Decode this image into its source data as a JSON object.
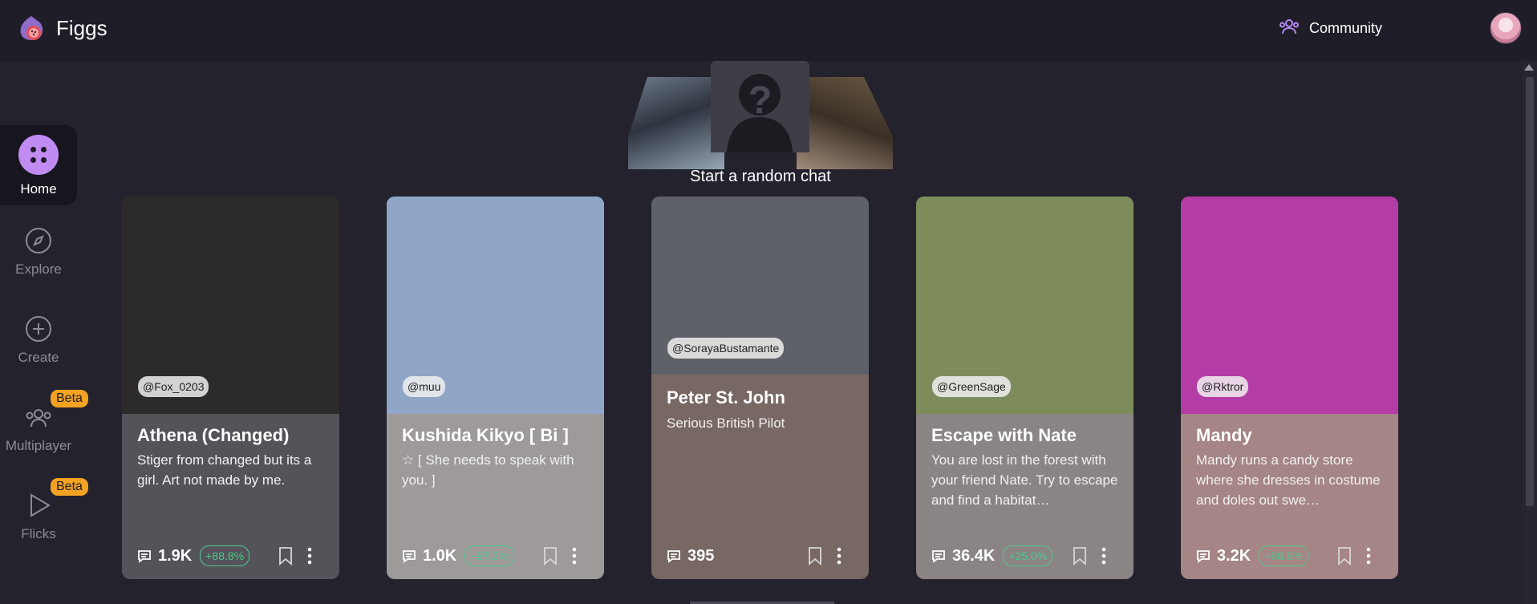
{
  "app": {
    "name": "Figgs"
  },
  "header": {
    "community_label": "Community"
  },
  "sidebar": {
    "items": [
      {
        "label": "Home"
      },
      {
        "label": "Explore"
      },
      {
        "label": "Create"
      },
      {
        "label": "Multiplayer",
        "badge": "Beta"
      },
      {
        "label": "Flicks",
        "badge": "Beta"
      }
    ]
  },
  "random_chat": {
    "label": "Start a random chat",
    "placeholder_glyph": "?"
  },
  "cards": [
    {
      "creator": "@Fox_0203",
      "name": "Athena (Changed)",
      "description": "Stiger from changed but its a girl. Art not made by me.",
      "count": "1.9K",
      "change": "+88.8%",
      "bg": "#55535a",
      "img_bg": "#2d2a2b"
    },
    {
      "creator": "@muu",
      "name": "Kushida Kikyo [ Bi ]",
      "description": "☆ [ She needs to speak with you. ]",
      "count": "1.0K",
      "change": "+97.2%",
      "bg": "#9d9a99",
      "img_bg": "#8fa6c7"
    },
    {
      "creator": "@SorayaBustamante",
      "name": "Peter St. John",
      "description": "Serious British Pilot",
      "count": "395",
      "change": "",
      "bg": "#786864",
      "img_bg": "#5e6168"
    },
    {
      "creator": "@GreenSage",
      "name": "Escape with Nate",
      "description": "You are lost in the forest with your friend Nate. Try to escape and find a habitat…",
      "count": "36.4K",
      "change": "+25.0%",
      "bg": "#8b8484",
      "img_bg": "#7e8c5c"
    },
    {
      "creator": "@Rktror",
      "name": "Mandy",
      "description": "Mandy runs a candy store where she dresses in costume and doles out swe…",
      "count": "3.2K",
      "change": "+98.8%",
      "bg": "#a58585",
      "img_bg": "#b43ca5"
    }
  ],
  "colors": {
    "accent": "#c08cf2",
    "beta": "#f4a221",
    "trend_green": "#4ec78b",
    "bg": "#24222d"
  }
}
